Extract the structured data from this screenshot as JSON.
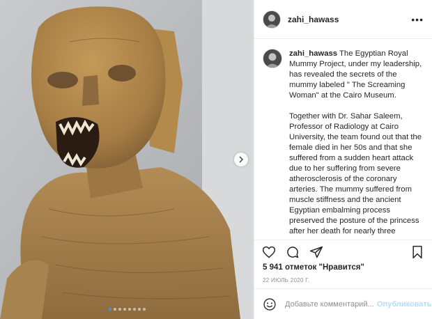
{
  "post": {
    "username": "zahi_hawass",
    "caption": "The Egyptian Royal Mummy Project, under my leadership, has revealed the secrets of the mummy labeled \" The Screaming Woman\" at the Cairo Museum.\n\nTogether with Dr. Sahar Saleem, Professor of Radiology at Cairo University, the team found out that the female died in her 50s and that she suffered from a sudden heart attack due to her suffering from severe atherosclerosis of the coronary arteries. The mummy suffered from muscle stiffness and the ancient Egyptian embalming process preserved the posture of the princess after her death for nearly three thousand years.\nMore studies revealed that the identity",
    "likes": "5 941 отметок \"Нравится\"",
    "date": "22 ИЮЛЬ 2020 Г.",
    "comment_placeholder": "Добавьте комментарий...",
    "publish_label": "Опубликовать",
    "more_icon": "•••"
  },
  "media": {
    "image_alt": "Mummy of The Screaming Woman",
    "carousel_total": 8,
    "carousel_active": 1
  }
}
